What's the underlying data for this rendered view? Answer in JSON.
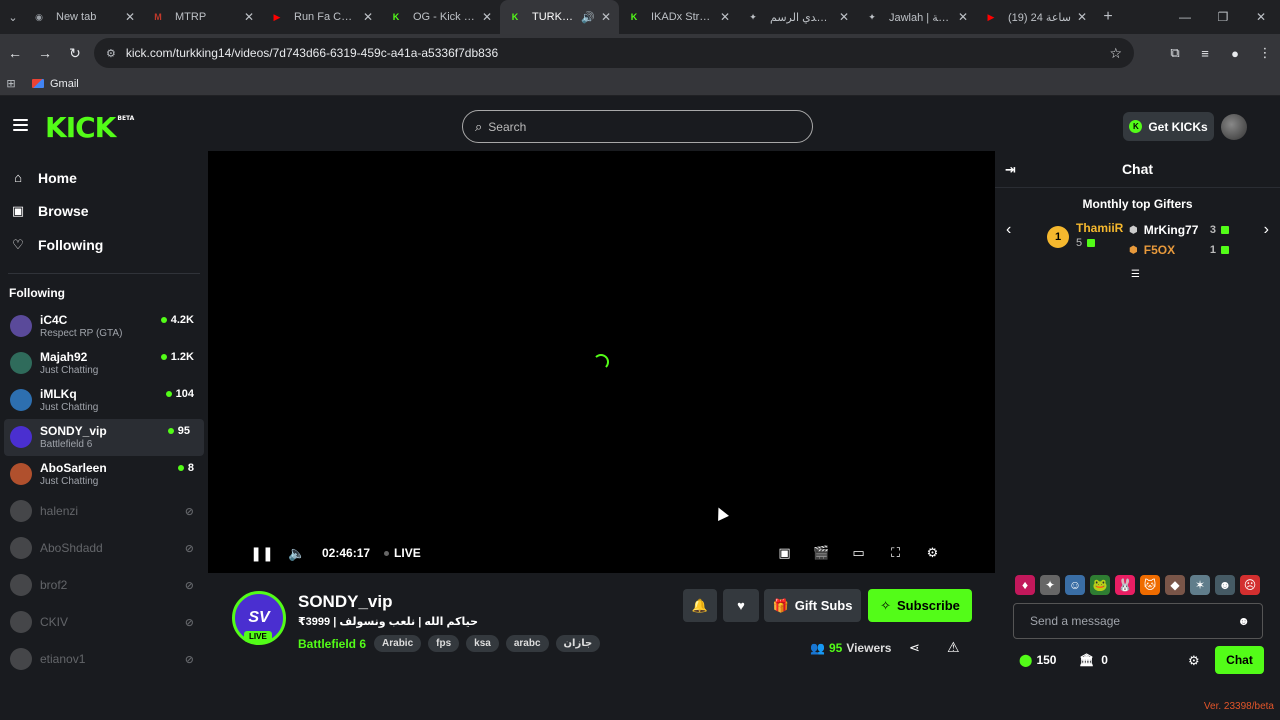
{
  "browser": {
    "tabs": [
      {
        "title": "New tab",
        "fav": "◉",
        "favcolor": "#9aa0a6"
      },
      {
        "title": "MTRP",
        "fav": "M",
        "favcolor": "#c0392b"
      },
      {
        "title": "Run Fa Cover",
        "fav": "▶",
        "favcolor": "#ff0000"
      },
      {
        "title": "OG - Kick Da",
        "fav": "K",
        "favcolor": "#53fc18"
      },
      {
        "title": "TURKking",
        "fav": "K",
        "favcolor": "#53fc18",
        "audio": "🔊"
      },
      {
        "title": "IKADx Stream",
        "fav": "K",
        "favcolor": "#53fc18"
      },
      {
        "title": "تحدي الرسم -",
        "fav": "✦",
        "favcolor": "#bdc1c6"
      },
      {
        "title": "Jawlah | جولة",
        "fav": "✦",
        "favcolor": "#bdc1c6"
      },
      {
        "title": "(19) 24 ساعة",
        "fav": "▶",
        "favcolor": "#ff0000"
      }
    ],
    "url": "kick.com/turkking14/videos/7d743d66-6319-459c-a41a-a5336f7db836",
    "bookmark": "Gmail"
  },
  "header": {
    "logo": "KICK",
    "logo_badge": "BETA",
    "search_placeholder": "Search",
    "get_kicks": "Get KICKs"
  },
  "sidebar": {
    "nav": [
      {
        "label": "Home",
        "icon": "⌂"
      },
      {
        "label": "Browse",
        "icon": "▣"
      },
      {
        "label": "Following",
        "icon": "♡"
      }
    ],
    "following_title": "Following",
    "channels": [
      {
        "name": "iC4C",
        "category": "Respect RP (GTA)",
        "viewers": "4.2K",
        "color": "#5a4a9a"
      },
      {
        "name": "Majah92",
        "category": "Just Chatting",
        "viewers": "1.2K",
        "color": "#2f6b5b"
      },
      {
        "name": "iMLKq",
        "category": "Just Chatting",
        "viewers": "104",
        "color": "#2d6fb0"
      },
      {
        "name": "SONDY_vip",
        "category": "Battlefield 6",
        "viewers": "95",
        "color": "#4a2fd0"
      },
      {
        "name": "AboSarleen",
        "category": "Just Chatting",
        "viewers": "8",
        "color": "#b0502d"
      }
    ],
    "offline": [
      {
        "name": "halenzi"
      },
      {
        "name": "AboShdadd"
      },
      {
        "name": "brof2"
      },
      {
        "name": "CKIV"
      },
      {
        "name": "etianov1"
      }
    ]
  },
  "player": {
    "time": "02:46:17",
    "live": "LIVE"
  },
  "stream": {
    "name": "SONDY_vip",
    "avatar": "SV",
    "live_badge": "LIVE",
    "title": "حياكم الله | نلعب ونسولف | 3999₹",
    "category": "Battlefield 6",
    "tags": [
      "Arabic",
      "fps",
      "ksa",
      "arabc",
      "جازان"
    ],
    "gift_subs": "Gift Subs",
    "subscribe": "Subscribe",
    "viewers_count": "95",
    "viewers_label": "Viewers"
  },
  "chat": {
    "title": "Chat",
    "gifters_title": "Monthly top Gifters",
    "top": {
      "rank": "1",
      "name": "ThamiiR",
      "count": "5"
    },
    "second": {
      "name": "MrKing77",
      "count": "3"
    },
    "third": {
      "name": "F5OX",
      "count": "1"
    },
    "placeholder": "Send a message",
    "points": "150",
    "inventory": "0",
    "send": "Chat",
    "version": "Ver. 23398/beta"
  }
}
